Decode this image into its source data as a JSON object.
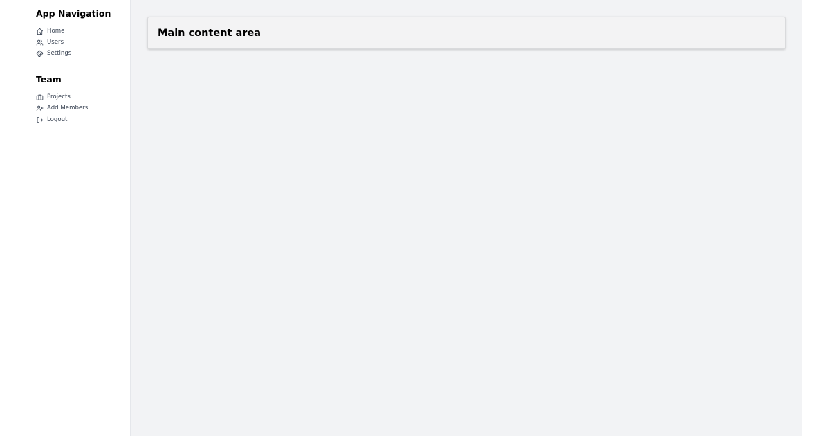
{
  "sidebar": {
    "sections": [
      {
        "title": "App Navigation",
        "items": [
          {
            "label": "Home",
            "icon": "home-icon"
          },
          {
            "label": "Users",
            "icon": "users-icon"
          },
          {
            "label": "Settings",
            "icon": "gear-icon"
          }
        ]
      },
      {
        "title": "Team",
        "items": [
          {
            "label": "Projects",
            "icon": "briefcase-icon"
          },
          {
            "label": "Add Members",
            "icon": "user-plus-icon"
          },
          {
            "label": "Logout",
            "icon": "logout-icon"
          }
        ]
      }
    ]
  },
  "main": {
    "card_title": "Main content area"
  },
  "colors": {
    "sidebar_bg": "#ffffff",
    "main_bg": "#f2f3f5",
    "card_bg": "#f3f3f4",
    "card_border": "#d9dadc",
    "text": "#000000",
    "nav_text": "#374151"
  }
}
